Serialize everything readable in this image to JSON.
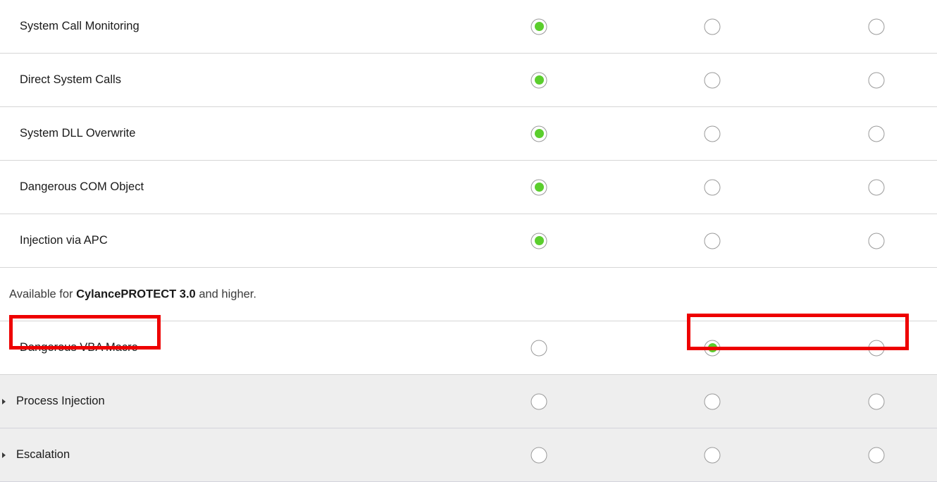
{
  "table": {
    "rows": [
      {
        "type": "option",
        "label": "System Call Monitoring",
        "selected_column": 1
      },
      {
        "type": "option",
        "label": "Direct System Calls",
        "selected_column": 1
      },
      {
        "type": "option",
        "label": "System DLL Overwrite",
        "selected_column": 1
      },
      {
        "type": "option",
        "label": "Dangerous COM Object",
        "selected_column": 1
      },
      {
        "type": "option",
        "label": "Injection via APC",
        "selected_column": 1
      },
      {
        "type": "note",
        "text_before": "Available for ",
        "text_strong": "CylancePROTECT 3.0",
        "text_after": " and higher."
      },
      {
        "type": "option",
        "label": "Dangerous VBA Macro",
        "selected_column": 2
      },
      {
        "type": "group",
        "label": "Process Injection",
        "selected_column": 0
      },
      {
        "type": "group",
        "label": "Escalation",
        "selected_column": 0
      }
    ]
  },
  "colors": {
    "selected_radio": "#5bce2d",
    "radio_border": "#9a9a9a",
    "row_divider": "#d6d6d6",
    "group_row_background": "#eeeeee",
    "annotation": "#ee0000",
    "text": "#1a1a1a"
  },
  "annotations": [
    {
      "name": "highlight-dangerous-vba-macro-label"
    },
    {
      "name": "highlight-dangerous-vba-macro-radios"
    }
  ]
}
